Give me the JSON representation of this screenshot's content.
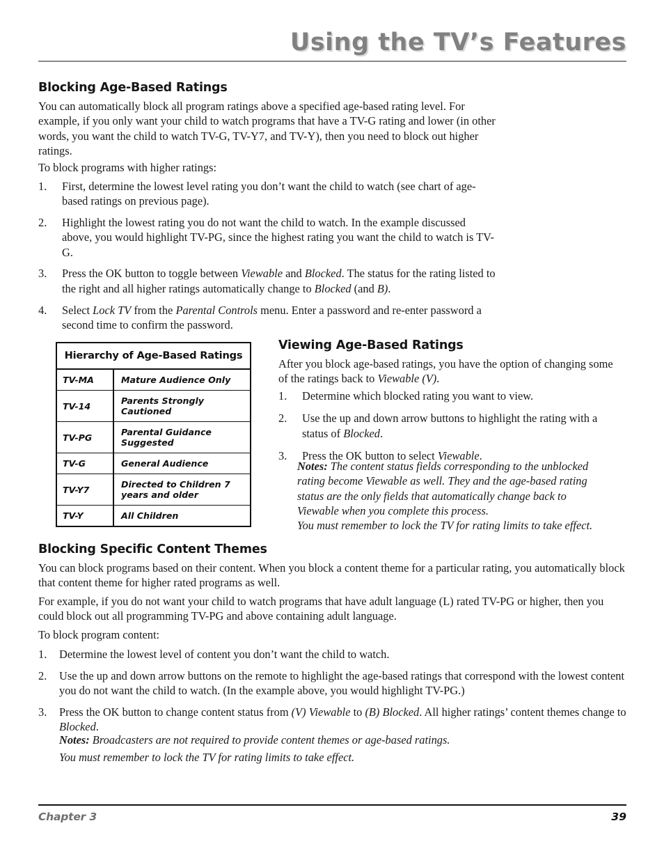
{
  "running_head": "Using the TV’s Features",
  "colors": {
    "running_head": "#818181",
    "running_head_shadow": "#d8d8d8",
    "rule_top": "#8a8a8a",
    "rule_bottom": "#111111",
    "footer_left": "#6f6f6f",
    "body_text": "#1a1a1a"
  },
  "sections": {
    "blocking_age": {
      "heading": "Blocking Age-Based Ratings",
      "intro": "You can automatically block all program ratings above a specified age-based rating level. For example, if you only want your child to watch programs that have a TV-G rating and lower (in other words, you want the child to watch TV-G, TV-Y7, and TV-Y), then you need to block out higher ratings.",
      "lead_in": "To block programs with higher ratings:",
      "steps": [
        {
          "num": "1.",
          "parts": [
            {
              "text": "First, determine the lowest level rating you don’t want the child to watch (see chart of age-based ratings on previous page).",
              "style": "normal"
            }
          ]
        },
        {
          "num": "2.",
          "parts": [
            {
              "text": "Highlight the lowest rating you do not want the child to watch. In the example discussed above, you would highlight TV-PG, since the highest rating you want the child to watch is TV-G.",
              "style": "normal"
            }
          ]
        },
        {
          "num": "3.",
          "parts": [
            {
              "text": "Press the OK button to toggle between ",
              "style": "normal"
            },
            {
              "text": "Viewable",
              "style": "italic"
            },
            {
              "text": " and ",
              "style": "normal"
            },
            {
              "text": "Blocked",
              "style": "italic"
            },
            {
              "text": ". The status for the rating listed to the right and all higher ratings automatically change to ",
              "style": "normal"
            },
            {
              "text": "Blocked",
              "style": "italic"
            },
            {
              "text": " (and ",
              "style": "normal"
            },
            {
              "text": "B)",
              "style": "italic"
            },
            {
              "text": ".",
              "style": "normal"
            }
          ]
        },
        {
          "num": "4.",
          "parts": [
            {
              "text": "Select ",
              "style": "normal"
            },
            {
              "text": "Lock TV",
              "style": "italic"
            },
            {
              "text": " from the ",
              "style": "normal"
            },
            {
              "text": "Parental Controls",
              "style": "italic"
            },
            {
              "text": " menu. Enter a password and re-enter password a second time to confirm the password.",
              "style": "normal"
            }
          ]
        }
      ]
    },
    "viewing_age": {
      "heading": "Viewing Age-Based Ratings",
      "intro_parts": [
        {
          "text": "After you block age-based ratings, you have the option of changing some of the ratings back to ",
          "style": "normal"
        },
        {
          "text": "Viewable (V)",
          "style": "italic"
        },
        {
          "text": ".",
          "style": "normal"
        }
      ],
      "steps": [
        {
          "num": "1.",
          "parts": [
            {
              "text": "Determine which blocked rating you want to view.",
              "style": "normal"
            }
          ]
        },
        {
          "num": "2.",
          "parts": [
            {
              "text": "Use the up and down arrow buttons to highlight the rating with a status of ",
              "style": "normal"
            },
            {
              "text": "Blocked",
              "style": "italic"
            },
            {
              "text": ".",
              "style": "normal"
            }
          ]
        },
        {
          "num": "3.",
          "parts": [
            {
              "text": "Press the OK button to select ",
              "style": "normal"
            },
            {
              "text": "Viewable",
              "style": "italic"
            },
            {
              "text": ".",
              "style": "normal"
            }
          ]
        }
      ],
      "note_label": "Notes:",
      "note_1": " The content status fields corresponding to the unblocked rating become Viewable as well. They and the age-based rating status are the only fields that automatically change back to Viewable when you complete this process.",
      "note_2": "You must remember to lock the TV for rating limits to take effect."
    },
    "blocking_themes": {
      "heading": "Blocking Specific Content Themes",
      "para_1": "You can block programs based on their content. When you block a content theme for a particular rating, you automatically block that content theme for higher rated programs as well.",
      "para_2": "For example, if you do not want your child to watch programs that have adult language (L) rated TV-PG or higher, then you could block out all programming TV-PG and above containing adult language.",
      "lead_in": "To block program content:",
      "steps": [
        {
          "num": "1.",
          "parts": [
            {
              "text": "Determine the lowest level of content you don’t want the child to watch.",
              "style": "normal"
            }
          ]
        },
        {
          "num": "2.",
          "parts": [
            {
              "text": "Use the up and down arrow buttons on the remote to highlight the age-based ratings that correspond with the lowest content you do not want the child to watch. (In the example above, you would highlight TV-PG.)",
              "style": "normal"
            }
          ]
        },
        {
          "num": "3.",
          "parts": [
            {
              "text": "Press the OK button to change content status from ",
              "style": "normal"
            },
            {
              "text": "(V) Viewable",
              "style": "italic"
            },
            {
              "text": " to ",
              "style": "normal"
            },
            {
              "text": "(B) Blocked",
              "style": "italic"
            },
            {
              "text": ". All higher ratings’ content themes change to ",
              "style": "normal"
            },
            {
              "text": "Blocked",
              "style": "italic"
            },
            {
              "text": ".",
              "style": "normal"
            }
          ]
        }
      ],
      "note_label": "Notes:",
      "note_1": "  Broadcasters are not required to provide content themes or age-based ratings.",
      "note_2": "You must remember to lock the TV for rating limits to take effect."
    }
  },
  "ratings_table": {
    "title": "Hierarchy of Age-Based Ratings",
    "rows": [
      {
        "rating": "TV-MA",
        "description": "Mature Audience Only"
      },
      {
        "rating": "TV-14",
        "description": "Parents Strongly Cautioned"
      },
      {
        "rating": "TV-PG",
        "description": "Parental Guidance Suggested"
      },
      {
        "rating": "TV-G",
        "description": "General Audience"
      },
      {
        "rating": "TV-Y7",
        "description": "Directed to Children 7 years and older"
      },
      {
        "rating": "TV-Y",
        "description": "All Children"
      }
    ]
  },
  "footer": {
    "chapter": "Chapter 3",
    "page_number": "39"
  }
}
